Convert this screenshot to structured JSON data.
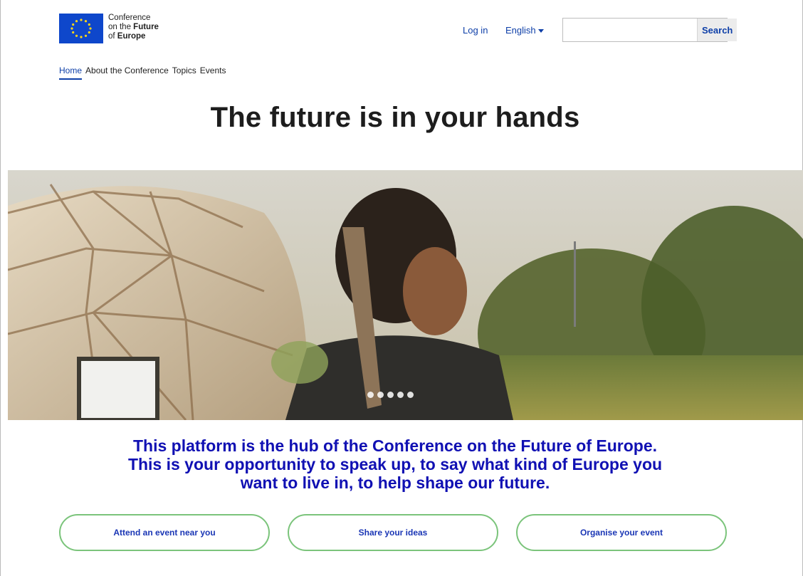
{
  "header": {
    "logo": {
      "line1": "Conference",
      "line2_prefix": "on the ",
      "line2_bold": "Future",
      "line3_prefix": "of ",
      "line3_bold": "Europe"
    },
    "login_label": "Log in",
    "language_label": "English",
    "search": {
      "value": "",
      "placeholder": "",
      "button_label": "Search"
    }
  },
  "nav": {
    "items": [
      {
        "label": "Home",
        "active": true
      },
      {
        "label": "About the Conference",
        "active": false
      },
      {
        "label": "Topics",
        "active": false
      },
      {
        "label": "Events",
        "active": false
      }
    ]
  },
  "hero": {
    "headline": "The future is in your hands",
    "slide_count": 5
  },
  "intro": {
    "line1": "This platform is the hub of the Conference on the Future of Europe.",
    "line2": "This is your opportunity to speak up, to say what kind of Europe you",
    "line3": "want to live in, to help shape our future."
  },
  "cta": {
    "attend_label": "Attend an event near you",
    "share_label": "Share your ideas",
    "organise_label": "Organise your event"
  },
  "colors": {
    "brand_blue": "#0e3fa8",
    "intro_blue": "#1010b3",
    "cta_border_green": "#7bc47b",
    "eu_flag_blue": "#0e47cb",
    "eu_star_yellow": "#ffd617"
  }
}
